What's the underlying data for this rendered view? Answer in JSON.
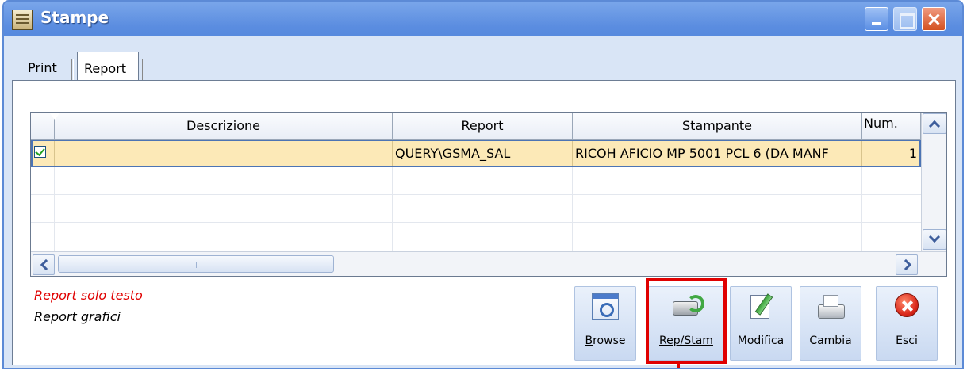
{
  "window": {
    "title": "Stampe"
  },
  "tabs": [
    {
      "label": "Print",
      "active": false
    },
    {
      "label": "Report",
      "active": true
    }
  ],
  "grid": {
    "columns": [
      "",
      "Descrizione",
      "Report",
      "Stampante",
      "Num."
    ],
    "rows": [
      {
        "checked": true,
        "descrizione": "",
        "report": "QUERY\\GSMA_SAL",
        "stampante": "RICOH AFICIO MP 5001 PCL 6 (DA MANF",
        "num": "1"
      }
    ]
  },
  "legend": {
    "text_only": "Report solo testo",
    "graphic": "Report grafici",
    "text_only_color": "#e00000"
  },
  "actions": [
    {
      "label": "Browse",
      "hotkey_char": "B",
      "icon": "browse-icon"
    },
    {
      "label": "Rep/Stam",
      "hotkey_char": "R",
      "icon": "printer-refresh-icon",
      "highlighted": true
    },
    {
      "label": "Modifica",
      "hotkey_char": "f",
      "icon": "edit-document-icon"
    },
    {
      "label": "Cambia",
      "hotkey_char": "C",
      "icon": "printer-icon"
    },
    {
      "label": "Esci",
      "hotkey_char": "E",
      "icon": "close-circle-icon"
    }
  ]
}
